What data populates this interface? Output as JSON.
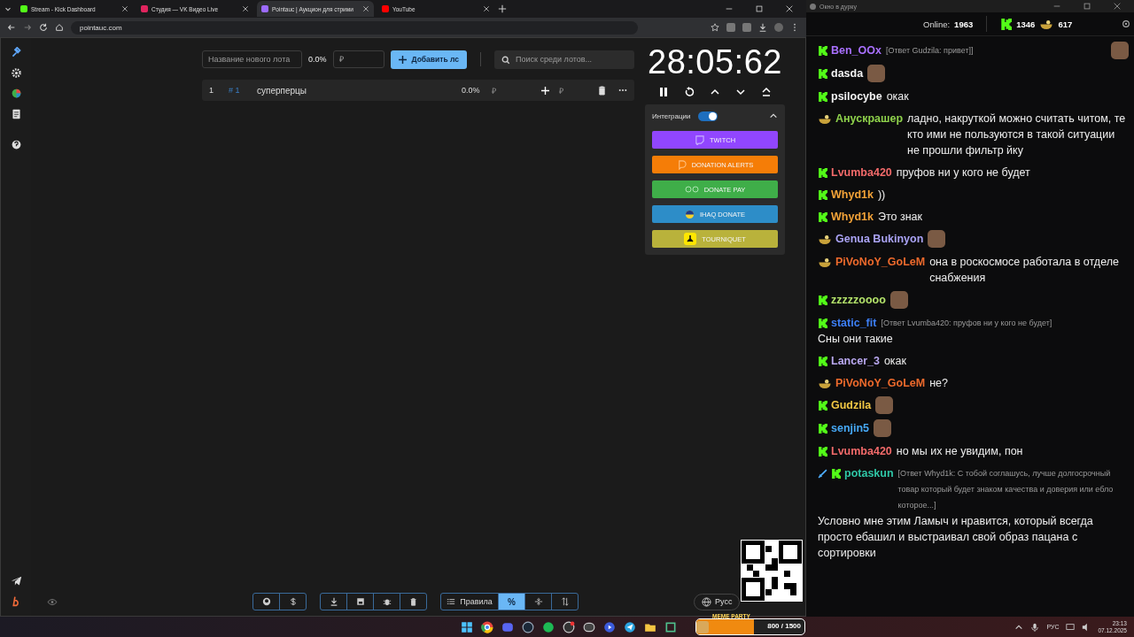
{
  "browser": {
    "tabs": [
      {
        "title": "Stream - Kick Dashboard",
        "kind": "kick",
        "selected": false
      },
      {
        "title": "Студия — VK Видео Live",
        "kind": "vk",
        "selected": false
      },
      {
        "title": "Pointauc | Аукцион для стрими",
        "kind": "pointauc",
        "selected": true
      },
      {
        "title": "YouTube",
        "kind": "youtube",
        "selected": false
      }
    ],
    "address": "pointauc.com"
  },
  "auction": {
    "new_lot": {
      "placeholder": "Название нового лота"
    },
    "new_lot_percent": "0.0%",
    "amount": {
      "placeholder": "₽"
    },
    "add_button": "Добавить лс",
    "search": {
      "placeholder": "Поиск среди лотов..."
    },
    "lots": [
      {
        "index": "1",
        "id": "# 1",
        "name": "суперперцы",
        "percent": "0.0%",
        "currency": "₽",
        "add_currency": "₽"
      }
    ]
  },
  "timer": {
    "time": "28:05:62"
  },
  "integrations": {
    "title": "Интеграции",
    "on": true,
    "services": [
      {
        "label": "TWITCH",
        "color": "#9146ff",
        "kind": "twitch"
      },
      {
        "label": "DONATION ALERTS",
        "color": "#f57d07",
        "kind": "da"
      },
      {
        "label": "DONATE PAY",
        "color": "#3fae49",
        "kind": "dp"
      },
      {
        "label": "IHAQ DONATE",
        "color": "#2d8dc8",
        "kind": "ihaq"
      },
      {
        "label": "TOURNIQUET",
        "color": "#b9b23b",
        "kind": "tq"
      }
    ]
  },
  "toolbar": {
    "rules_label": "Правила",
    "percent": {
      "label": "%",
      "selected": true
    },
    "language": "Русс"
  },
  "chat": {
    "window_title": "Окно в дурку",
    "online_label": "Online:",
    "online": "1963",
    "kick_count": "1346",
    "other_count": "617",
    "messages": [
      {
        "badges": [
          {
            "kind": "kick"
          }
        ],
        "name": "Ben_OOx",
        "color": "#a970ff",
        "reply": "[Ответ Gudzila: привет]]",
        "emote": true
      },
      {
        "badges": [
          {
            "kind": "kick"
          }
        ],
        "name": "dasda",
        "color": "#f2f2f2",
        "emote": true
      },
      {
        "badges": [
          {
            "kind": "kick"
          }
        ],
        "name": "psilocybe",
        "color": "#f2f2f2",
        "text": "окак"
      },
      {
        "badges": [
          {
            "kind": "bowl"
          }
        ],
        "name": "Анускрашер",
        "color": "#8ed14b",
        "text": "ладно, накруткой можно считать читом, те кто ими не пользуются в такой ситуации не прошли фильтр йку"
      },
      {
        "badges": [
          {
            "kind": "kick"
          }
        ],
        "name": "Lvumba420",
        "color": "#f26a6a",
        "text": "пруфов ни у кого не будет"
      },
      {
        "badges": [
          {
            "kind": "kick"
          }
        ],
        "name": "Whyd1k",
        "color": "#f4a338",
        "text": "))"
      },
      {
        "badges": [
          {
            "kind": "kick"
          }
        ],
        "name": "Whyd1k",
        "color": "#f4a338",
        "text": "Это знак"
      },
      {
        "badges": [
          {
            "kind": "bowl"
          }
        ],
        "name": "Genua Bukinyon",
        "color": "#aaa3f5",
        "emote": true
      },
      {
        "badges": [
          {
            "kind": "bowl"
          }
        ],
        "name": "PiVoNoY_GoLeM",
        "color": "#ee6a2c",
        "text": "она в роскосмосе работала в отделе снабжения"
      },
      {
        "badges": [
          {
            "kind": "kick"
          }
        ],
        "name": "zzzzzoooo",
        "color": "#b3e26a",
        "emote": true
      },
      {
        "badges": [
          {
            "kind": "kick"
          }
        ],
        "name": "static_fit",
        "color": "#3d7ff5",
        "reply": "[Ответ Lvumba420: пруфов ни у кого не будет]",
        "text": "Сны они такие"
      },
      {
        "badges": [
          {
            "kind": "kick"
          }
        ],
        "name": "Lancer_3",
        "color": "#b9a8f0",
        "text": "окак"
      },
      {
        "badges": [
          {
            "kind": "bowl"
          }
        ],
        "name": "PiVoNoY_GoLeM",
        "color": "#ee6a2c",
        "text": "не?"
      },
      {
        "badges": [
          {
            "kind": "kick"
          }
        ],
        "name": "Gudzila",
        "color": "#f2c744",
        "emote": true
      },
      {
        "badges": [
          {
            "kind": "kick"
          }
        ],
        "name": "senjin5",
        "color": "#46a8f5",
        "emote": true
      },
      {
        "badges": [
          {
            "kind": "kick"
          }
        ],
        "name": "Lvumba420",
        "color": "#f26a6a",
        "text": "но мы их не увидим, пон"
      },
      {
        "badges": [
          {
            "kind": "sword"
          },
          {
            "kind": "kick"
          }
        ],
        "name": "potaskun",
        "color": "#2fc6a6",
        "reply": "[Ответ Whyd1k: С тобой соглашусь, лучше долгосрочный товар который будет знаком качества и доверия или ебло которое...]",
        "text": "Условно мне этим Ламыч и нравится, который всегда просто ебашил и выстраивал свой образ пацана с сортировки"
      }
    ]
  },
  "meme_party": {
    "title": "MEME PARTY",
    "progress": "800 / 1500",
    "level": 0.53
  },
  "taskbar": {
    "language": "РУС",
    "time": "23:13",
    "date": "07.12.2025"
  }
}
